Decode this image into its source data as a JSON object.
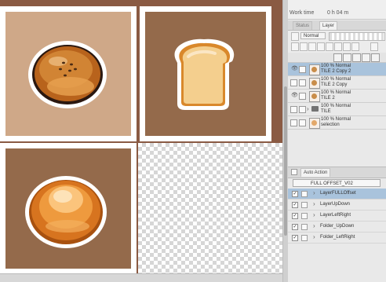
{
  "navigator": {
    "label": "Work time",
    "time": "0 h 04 m"
  },
  "panel_tabs": [
    "Status",
    "Layer"
  ],
  "layer_panel": {
    "blend_mode": "Normal",
    "layers": [
      {
        "line1": "100 % Normal",
        "line2": "TILE 2 Copy 2",
        "selected": true,
        "visible": true,
        "type": "raster"
      },
      {
        "line1": "100 % Normal",
        "line2": "TILE 2 Copy",
        "selected": false,
        "visible": false,
        "type": "raster"
      },
      {
        "line1": "100 % Normal",
        "line2": "TILE 2",
        "selected": false,
        "visible": true,
        "type": "raster"
      },
      {
        "line1": "100 % Normal",
        "line2": "TILE",
        "selected": false,
        "visible": false,
        "type": "folder"
      },
      {
        "line1": "100 % Normal",
        "line2": "selection",
        "selected": false,
        "visible": false,
        "type": "raster"
      }
    ]
  },
  "auto_action": {
    "tab_label": "Auto Action",
    "set_name": "FULL OFFSET_V02",
    "items": [
      {
        "label": "LayerFULLOffset",
        "selected": true
      },
      {
        "label": "LayerUpDown",
        "selected": false
      },
      {
        "label": "LayerLeftRight",
        "selected": false
      },
      {
        "label": "Folder_UpDown",
        "selected": false
      },
      {
        "label": "Folder_LeftRight",
        "selected": false
      }
    ]
  },
  "colors": {
    "canvas_bg": "#8a5a43",
    "tile_light": "#cfa888",
    "tile_dark": "#946a4b",
    "selection": "#a9c3dc"
  }
}
